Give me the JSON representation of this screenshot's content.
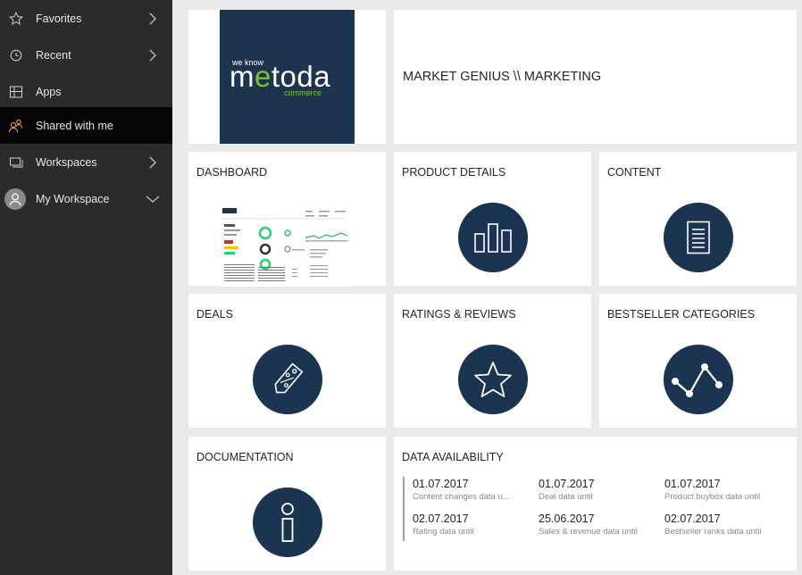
{
  "sidebar": {
    "items": [
      {
        "label": "Favorites",
        "icon": "star-icon",
        "chevron": "right",
        "active": false
      },
      {
        "label": "Recent",
        "icon": "clock-icon",
        "chevron": "right",
        "active": false
      },
      {
        "label": "Apps",
        "icon": "apps-icon",
        "chevron": "",
        "active": false
      },
      {
        "label": "Shared with me",
        "icon": "shared-users-icon",
        "chevron": "",
        "active": true
      },
      {
        "label": "Workspaces",
        "icon": "workspaces-icon",
        "chevron": "right",
        "active": false
      },
      {
        "label": "My Workspace",
        "icon": "user-avatar-icon",
        "chevron": "down",
        "active": false
      }
    ]
  },
  "logo": {
    "tagline": "we know",
    "brand_prefix": "m",
    "brand_accent": "e",
    "brand_suffix": "toda",
    "subtitle": "commerce"
  },
  "header": {
    "title": "MARKET GENIUS \\\\ MARKETING"
  },
  "tiles": {
    "dashboard": "DASHBOARD",
    "product_details": "PRODUCT DETAILS",
    "content": "CONTENT",
    "deals": "DEALS",
    "ratings": "RATINGS & REVIEWS",
    "bestseller": "BESTSELLER CATEGORIES",
    "documentation": "DOCUMENTATION",
    "data_availability": "DATA AVAILABILITY"
  },
  "data_availability": [
    {
      "date": "01.07.2017",
      "label": "Content changes data u..."
    },
    {
      "date": "01.07.2017",
      "label": "Deal data until"
    },
    {
      "date": "01.07.2017",
      "label": "Product buybox data until"
    },
    {
      "date": "02.07.2017",
      "label": "Rating data until"
    },
    {
      "date": "25.06.2017",
      "label": "Sales & revenue data until"
    },
    {
      "date": "02.07.2017",
      "label": "Bestseller ranks data until"
    }
  ],
  "colors": {
    "sidebar_bg": "#2b2b2b",
    "sidebar_active": "#050505",
    "shared_icon": "#e8a33b",
    "tile_circle": "#1a3451",
    "logo_bg": "#1d344e",
    "logo_accent": "#7dc22d"
  }
}
